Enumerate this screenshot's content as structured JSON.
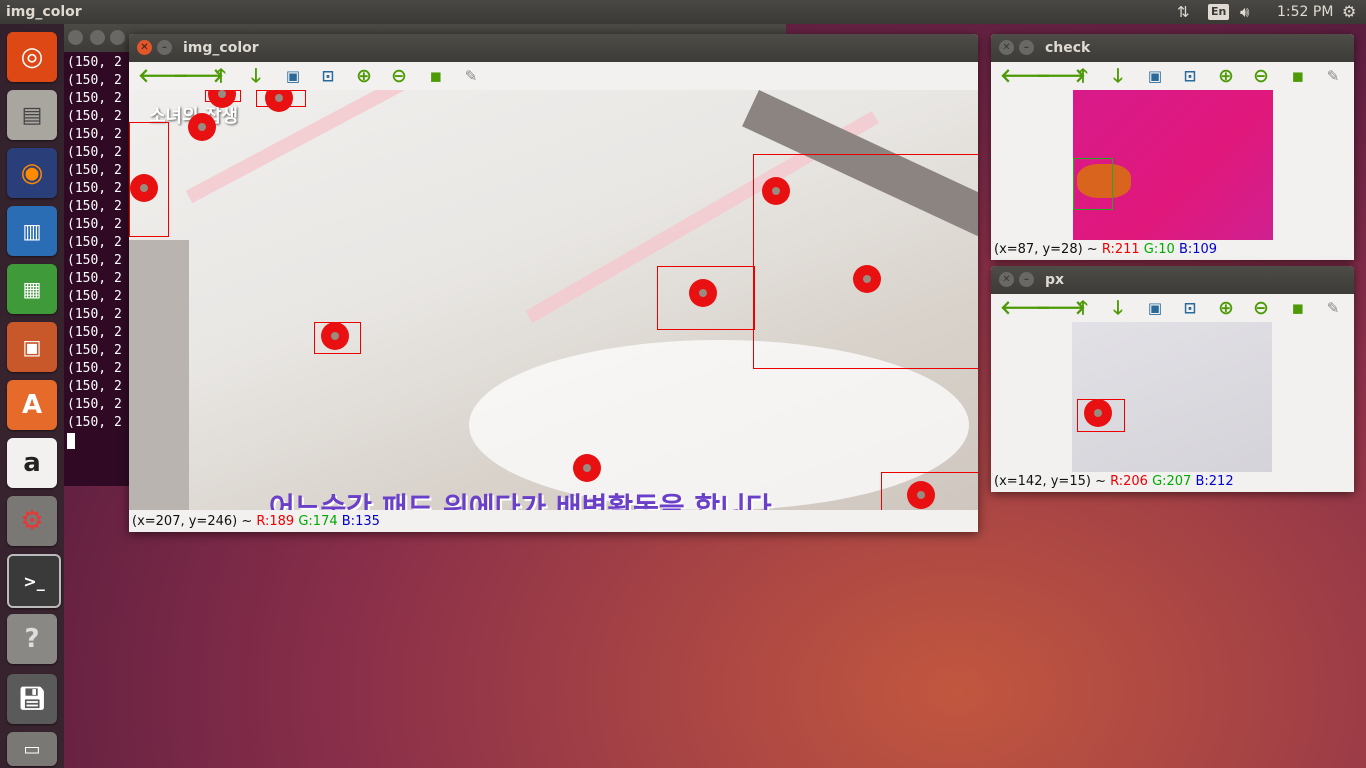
{
  "top_panel": {
    "title": "img_color",
    "keyboard": "En",
    "time": "1:52 PM",
    "icons": [
      "network-icon",
      "volume-icon",
      "settings-gear-icon"
    ]
  },
  "launcher": {
    "items": [
      "ubuntu-dash-icon",
      "files-icon",
      "firefox-icon",
      "writer-icon",
      "calc-icon",
      "impress-icon",
      "software-center-icon",
      "amazon-icon",
      "system-settings-icon",
      "terminal-icon",
      "help-icon",
      "save-drive-icon",
      "trash-icon"
    ]
  },
  "terminal": {
    "line_text": "(150, 2",
    "line_count": 21
  },
  "img_color": {
    "title": "img_color",
    "toolbar": [
      "arrow-left-icon",
      "arrow-right-icon",
      "arrow-up-icon",
      "arrow-down-icon",
      "fit-window-icon",
      "zoom-window-icon",
      "zoom-in-icon",
      "zoom-out-icon",
      "save-icon",
      "properties-brush-icon"
    ],
    "status": {
      "coords": "(x=207, y=246) ~ ",
      "r": "R:189",
      "g": "G:174",
      "b": "B:135"
    },
    "caption": "어느순간 패드 위에다가 배변활동을 합니다",
    "watermark": "소녀의 잡생"
  },
  "check": {
    "title": "check",
    "status": {
      "coords": "(x=87, y=28) ~ ",
      "r": "R:211",
      "g": "G:10",
      "b": "B:109"
    }
  },
  "px": {
    "title": "px",
    "status": {
      "coords": "(x=142, y=15) ~ ",
      "r": "R:206",
      "g": "G:207",
      "b": "B:212"
    }
  },
  "colors": {
    "detection": "#e81010",
    "ubuntu_orange": "#e0572b",
    "check_magenta": "#d81a8a"
  }
}
